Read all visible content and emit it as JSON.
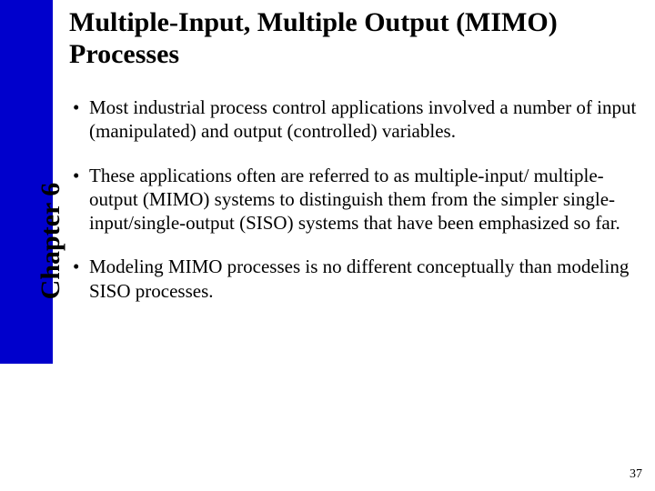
{
  "sidebar": {
    "chapter_label": "Chapter 6"
  },
  "title": "Multiple-Input, Multiple Output (MIMO) Processes",
  "bullets": [
    {
      "marker": "•",
      "text": "Most industrial process control applications involved a number of input (manipulated) and output (controlled) variables."
    },
    {
      "marker": "•",
      "text": "These applications often are referred to as multiple-input/ multiple-output (MIMO) systems to distinguish them from the simpler single-input/single-output (SISO) systems that have been emphasized so far."
    },
    {
      "marker": "•",
      "text": "Modeling MIMO processes is no different conceptually than modeling SISO processes."
    }
  ],
  "page_number": "37"
}
